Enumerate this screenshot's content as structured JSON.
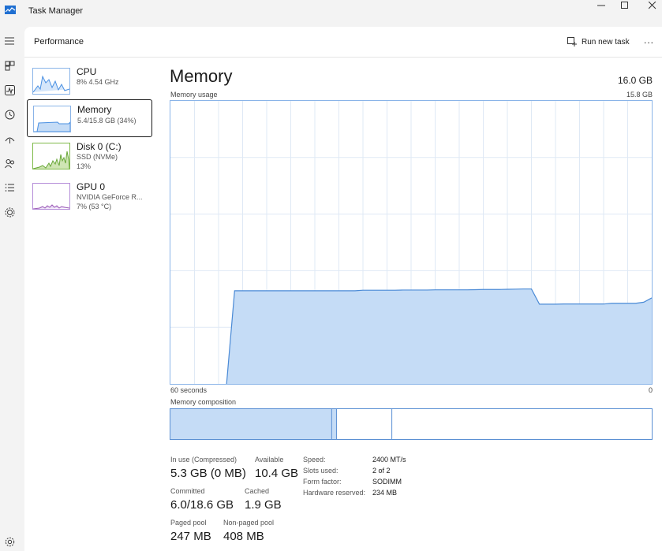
{
  "app": {
    "title": "Task Manager"
  },
  "header": {
    "title": "Performance",
    "run_task_label": "Run new task",
    "more_label": "..."
  },
  "devices": [
    {
      "name": "CPU",
      "sub1": "8%  4.54 GHz",
      "sub2": ""
    },
    {
      "name": "Memory",
      "sub1": "5.4/15.8 GB (34%)",
      "sub2": ""
    },
    {
      "name": "Disk 0 (C:)",
      "sub1": "SSD (NVMe)",
      "sub2": "13%"
    },
    {
      "name": "GPU 0",
      "sub1": "NVIDIA GeForce R...",
      "sub2": "7%  (53 °C)"
    }
  ],
  "selected_device": "Memory",
  "memory": {
    "title": "Memory",
    "total": "16.0 GB",
    "usage_label": "Memory usage",
    "usage_max": "15.8 GB",
    "time_left": "60 seconds",
    "time_right": "0",
    "composition_label": "Memory composition",
    "composition": {
      "in_use_fraction": 0.335,
      "modified_fraction": 0.01,
      "standby_fraction": 0.115
    }
  },
  "stats": {
    "in_use_label": "In use (Compressed)",
    "in_use_value": "5.3 GB (0 MB)",
    "available_label": "Available",
    "available_value": "10.4 GB",
    "committed_label": "Committed",
    "committed_value": "6.0/18.6 GB",
    "cached_label": "Cached",
    "cached_value": "1.9 GB",
    "paged_label": "Paged pool",
    "paged_value": "247 MB",
    "nonpaged_label": "Non-paged pool",
    "nonpaged_value": "408 MB"
  },
  "details": [
    {
      "label": "Speed:",
      "value": "2400 MT/s"
    },
    {
      "label": "Slots used:",
      "value": "2 of 2"
    },
    {
      "label": "Form factor:",
      "value": "SODIMM"
    },
    {
      "label": "Hardware reserved:",
      "value": "234 MB"
    }
  ],
  "chart_data": {
    "type": "area",
    "xlabel": "",
    "ylabel": "",
    "x": [
      60,
      59,
      58,
      57,
      56,
      55,
      54,
      53,
      52,
      51,
      50,
      49,
      48,
      47,
      46,
      45,
      44,
      43,
      42,
      41,
      40,
      39,
      38,
      37,
      36,
      35,
      34,
      33,
      32,
      31,
      30,
      29,
      28,
      27,
      26,
      25,
      24,
      23,
      22,
      21,
      20,
      19,
      18,
      17,
      16,
      15,
      14,
      13,
      12,
      11,
      10,
      9,
      8,
      7,
      6,
      5,
      4,
      3,
      2,
      1,
      0
    ],
    "series": [
      {
        "values": [
          null,
          null,
          null,
          null,
          null,
          null,
          null,
          0.0,
          5.2,
          5.2,
          5.2,
          5.2,
          5.2,
          5.2,
          5.2,
          5.2,
          5.2,
          5.2,
          5.2,
          5.2,
          5.2,
          5.2,
          5.2,
          5.2,
          5.23,
          5.23,
          5.23,
          5.23,
          5.23,
          5.24,
          5.24,
          5.24,
          5.24,
          5.25,
          5.25,
          5.25,
          5.25,
          5.25,
          5.26,
          5.27,
          5.27,
          5.27,
          5.28,
          5.29,
          5.3,
          5.3,
          4.45,
          4.45,
          4.45,
          4.46,
          4.46,
          4.46,
          4.46,
          4.46,
          4.46,
          4.5,
          4.5,
          4.5,
          4.5,
          4.56,
          4.8
        ]
      }
    ],
    "ylim": [
      0,
      15.8
    ],
    "xlim": [
      60,
      0
    ],
    "grid": true
  }
}
